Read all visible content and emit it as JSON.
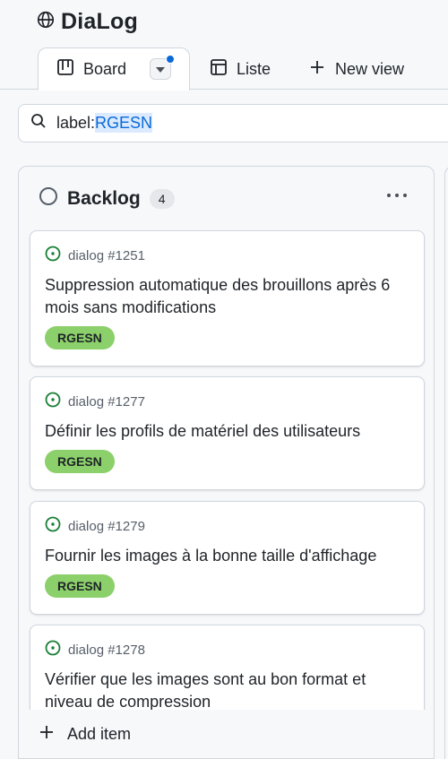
{
  "project": {
    "title": "DiaLog"
  },
  "tabs": [
    {
      "label": "Board",
      "active": true
    },
    {
      "label": "Liste",
      "active": false
    },
    {
      "label": "New view",
      "active": false
    }
  ],
  "filter": {
    "prefix": "label:",
    "value": "RGESN"
  },
  "column": {
    "title": "Backlog",
    "count": "4",
    "add_item_label": "Add item",
    "cards": [
      {
        "ref": "dialog #1251",
        "title": "Suppression automatique des brouillons après 6 mois sans modifications",
        "label": "RGESN"
      },
      {
        "ref": "dialog #1277",
        "title": "Définir les profils de matériel des utilisateurs",
        "label": "RGESN"
      },
      {
        "ref": "dialog #1279",
        "title": "Fournir les images à la bonne taille d'affichage",
        "label": "RGESN"
      },
      {
        "ref": "dialog #1278",
        "title": "Vérifier que les images sont au bon format et niveau de compression",
        "label": ""
      }
    ]
  },
  "colors": {
    "label_green": "#8bd06a",
    "issue_open_green": "#1a7f37",
    "accent_blue": "#0969da"
  },
  "icons": {
    "project": "globe-icon",
    "board": "board-icon",
    "list": "table-icon",
    "new_view": "plus-icon",
    "search": "search-icon",
    "column_status": "circle-icon",
    "issue": "issue-open-icon",
    "add": "plus-icon"
  }
}
